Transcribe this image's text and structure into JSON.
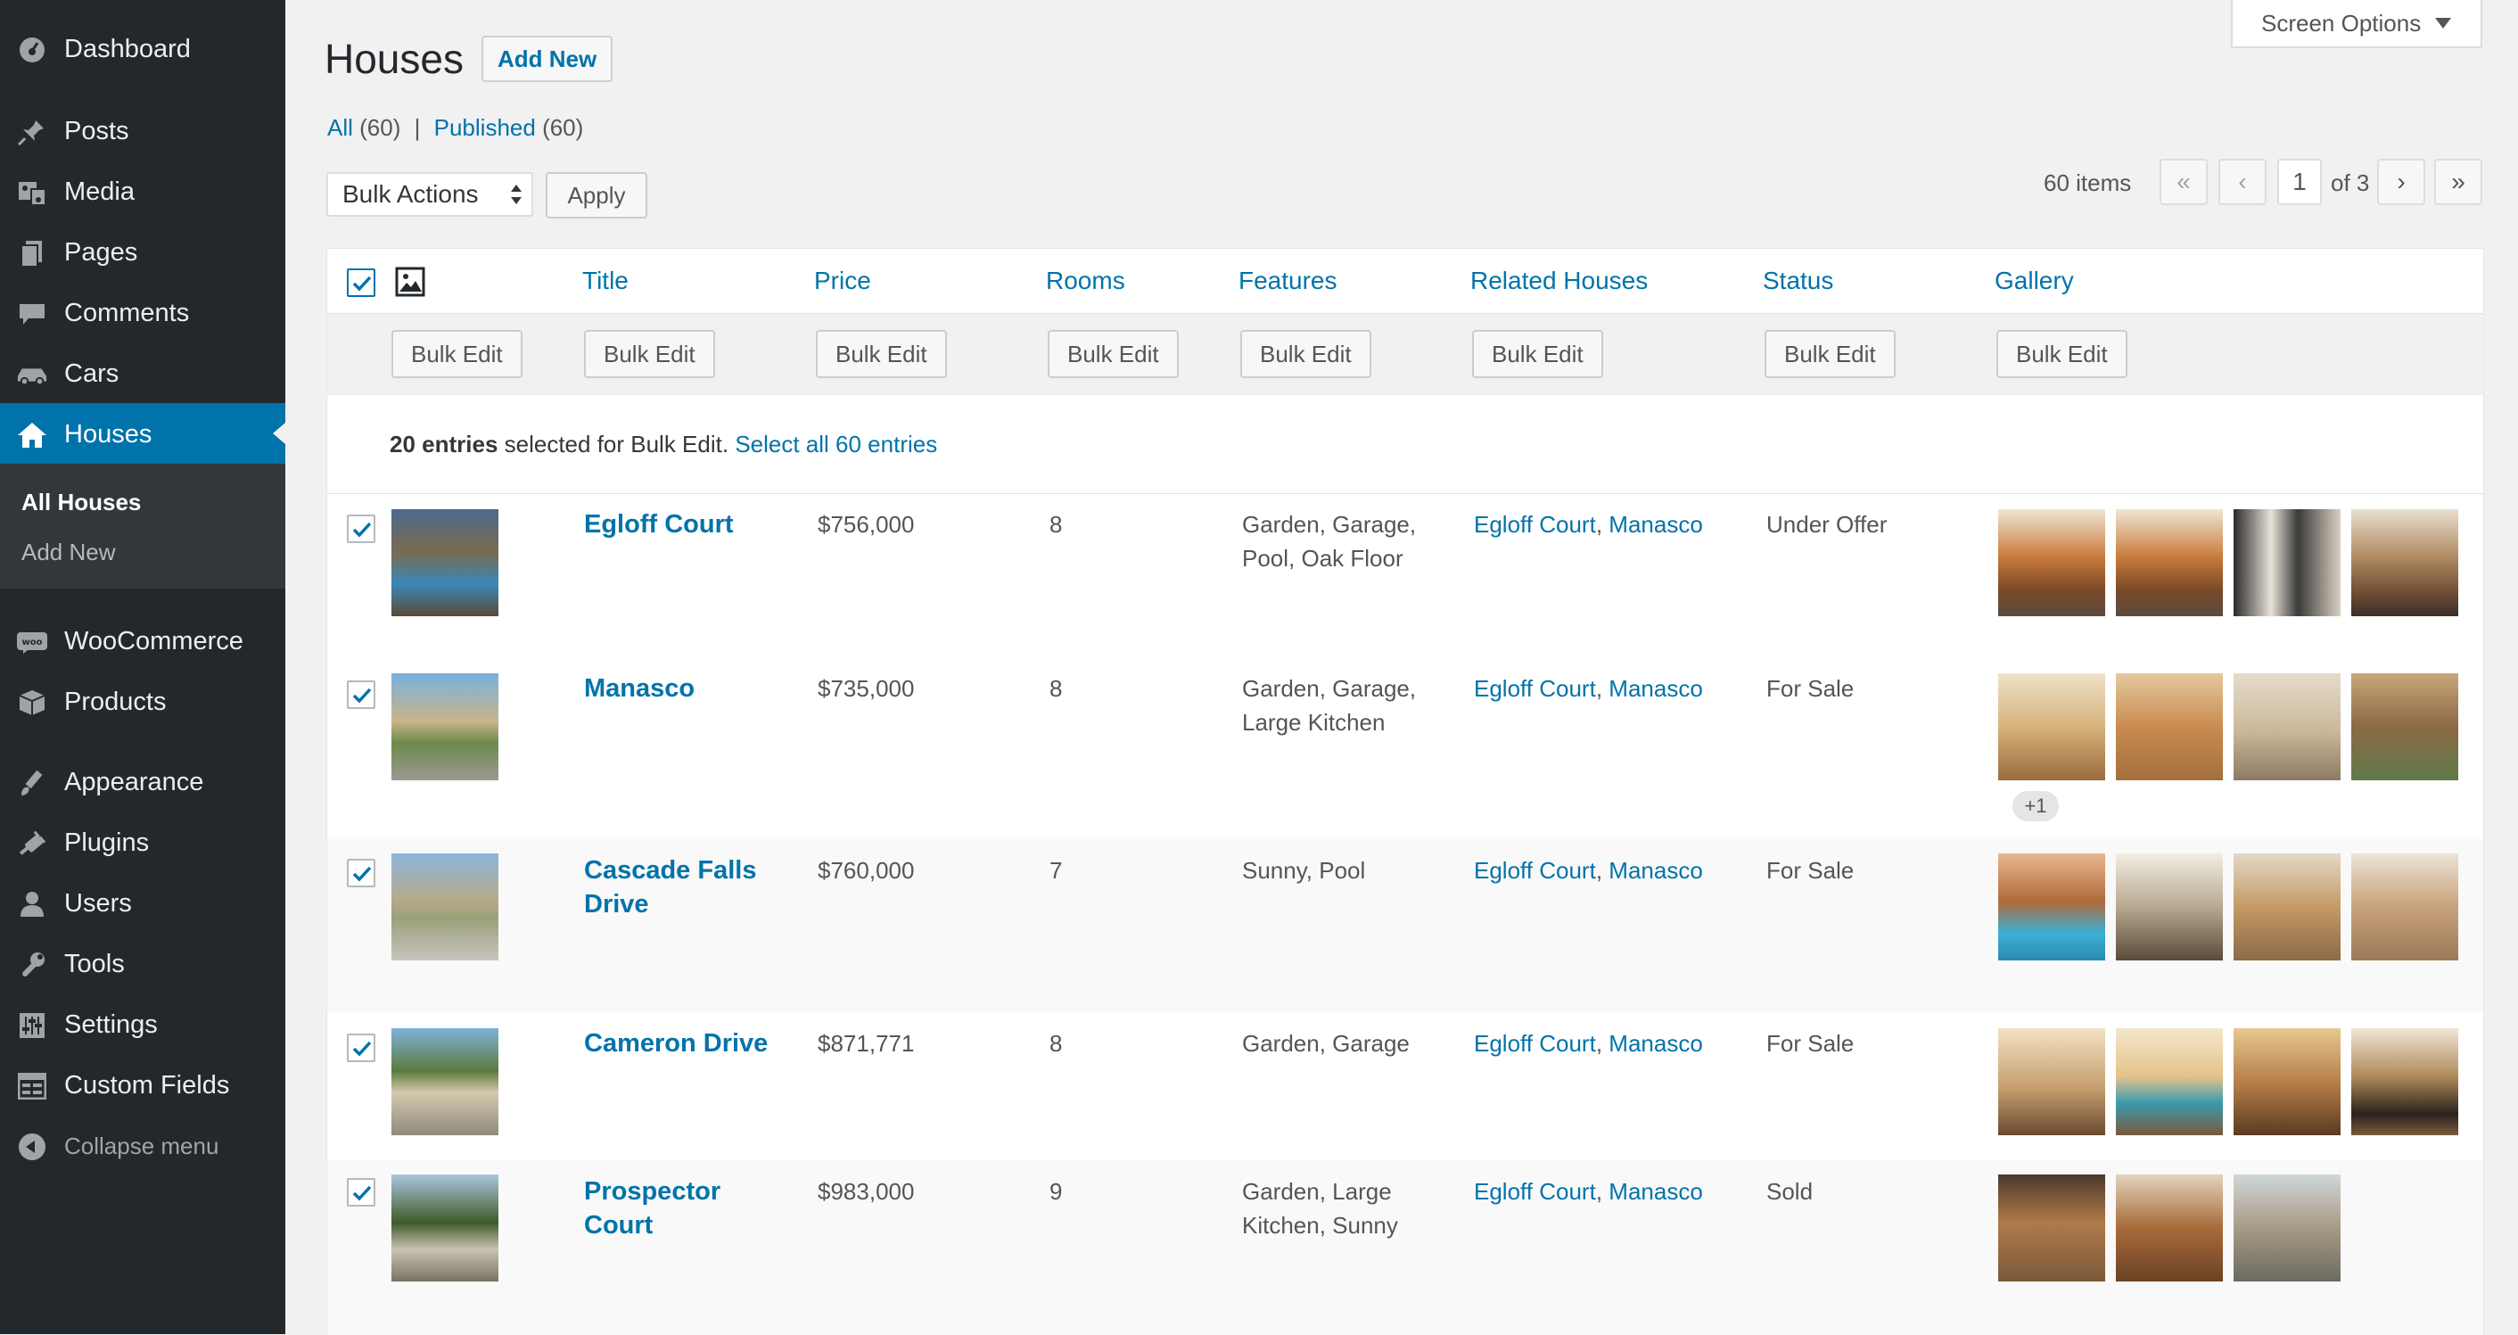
{
  "sidebar": {
    "items": [
      {
        "label": "Dashboard",
        "icon": "dashboard-icon"
      },
      {
        "label": "Posts",
        "icon": "pin-icon"
      },
      {
        "label": "Media",
        "icon": "media-icon"
      },
      {
        "label": "Pages",
        "icon": "pages-icon"
      },
      {
        "label": "Comments",
        "icon": "comment-icon"
      },
      {
        "label": "Cars",
        "icon": "car-icon"
      },
      {
        "label": "Houses",
        "icon": "home-icon"
      },
      {
        "label": "WooCommerce",
        "icon": "woo-icon"
      },
      {
        "label": "Products",
        "icon": "box-icon"
      },
      {
        "label": "Appearance",
        "icon": "brush-icon"
      },
      {
        "label": "Plugins",
        "icon": "plug-icon"
      },
      {
        "label": "Users",
        "icon": "user-icon"
      },
      {
        "label": "Tools",
        "icon": "wrench-icon"
      },
      {
        "label": "Settings",
        "icon": "sliders-icon"
      },
      {
        "label": "Custom Fields",
        "icon": "fields-icon"
      }
    ],
    "submenu": {
      "all_houses": "All Houses",
      "add_new": "Add New"
    },
    "collapse": "Collapse menu",
    "active_color": "#0073aa"
  },
  "header": {
    "title": "Houses",
    "add_new": "Add New",
    "screen_options": "Screen Options"
  },
  "filters": {
    "all_label": "All",
    "all_count": "(60)",
    "separator": "|",
    "published_label": "Published",
    "published_count": "(60)"
  },
  "bulk": {
    "select_value": "Bulk Actions",
    "apply": "Apply"
  },
  "pagination": {
    "items": "60 items",
    "first": "«",
    "prev": "‹",
    "current": "1",
    "of": "of 3",
    "next": "›",
    "last": "»"
  },
  "table": {
    "columns": [
      "Title",
      "Price",
      "Rooms",
      "Features",
      "Related Houses",
      "Status",
      "Gallery"
    ],
    "bulk_edit_label": "Bulk Edit",
    "selection": {
      "count": "20 entries",
      "text": " selected for Bulk Edit. ",
      "select_all": "Select all 60 entries"
    },
    "rows": [
      {
        "title": "Egloff Court",
        "price": "$756,000",
        "rooms": "8",
        "features": "Garden, Garage, Pool, Oak Floor",
        "related": [
          "Egloff Court",
          "Manasco"
        ],
        "status": "Under Offer"
      },
      {
        "title": "Manasco",
        "price": "$735,000",
        "rooms": "8",
        "features": "Garden, Garage, Large Kitchen",
        "related": [
          "Egloff Court",
          "Manasco"
        ],
        "status": "For Sale",
        "more": "+1"
      },
      {
        "title": "Cascade Falls Drive",
        "price": "$760,000",
        "rooms": "7",
        "features": "Sunny, Pool",
        "related": [
          "Egloff Court",
          "Manasco"
        ],
        "status": "For Sale"
      },
      {
        "title": "Cameron Drive",
        "price": "$871,771",
        "rooms": "8",
        "features": "Garden, Garage",
        "related": [
          "Egloff Court",
          "Manasco"
        ],
        "status": "For Sale"
      },
      {
        "title": "Prospector Court",
        "price": "$983,000",
        "rooms": "9",
        "features": "Garden, Large Kitchen, Sunny",
        "related": [
          "Egloff Court",
          "Manasco"
        ],
        "status": "Sold"
      }
    ],
    "related_separator": ","
  }
}
